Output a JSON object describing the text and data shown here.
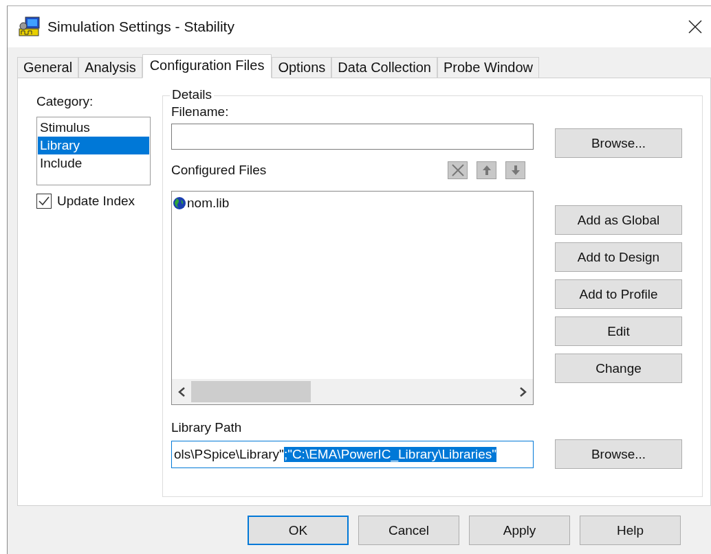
{
  "window": {
    "title": "Simulation Settings - Stability"
  },
  "tabs": [
    {
      "label": "General",
      "selected": false
    },
    {
      "label": "Analysis",
      "selected": false
    },
    {
      "label": "Configuration Files",
      "selected": true
    },
    {
      "label": "Options",
      "selected": false
    },
    {
      "label": "Data Collection",
      "selected": false
    },
    {
      "label": "Probe Window",
      "selected": false
    }
  ],
  "category": {
    "label": "Category:",
    "items": [
      {
        "label": "Stimulus",
        "selected": false
      },
      {
        "label": "Library",
        "selected": true
      },
      {
        "label": "Include",
        "selected": false
      }
    ]
  },
  "update_index": {
    "label": "Update Index",
    "checked": true
  },
  "details": {
    "title": "Details",
    "filename_label": "Filename:",
    "filename_button": "Browse...",
    "configured_label": "Configured Files",
    "files": [
      {
        "name": "nom.lib"
      }
    ],
    "side_buttons": [
      "Add as Global",
      "Add to Design",
      "Add to Profile",
      "Edit",
      "Change"
    ],
    "library_path_label": "Library Path",
    "library_path": {
      "value": "ols\\PSpice\\Library\"",
      "selected_text": ";\"C:\\EMA\\PowerIC_Library\\Libraries\""
    },
    "library_button": "Browse..."
  },
  "buttons": [
    {
      "label": "OK",
      "default": true
    },
    {
      "label": "Cancel",
      "default": false
    },
    {
      "label": "Apply",
      "default": false
    },
    {
      "label": "Help",
      "default": false
    }
  ]
}
